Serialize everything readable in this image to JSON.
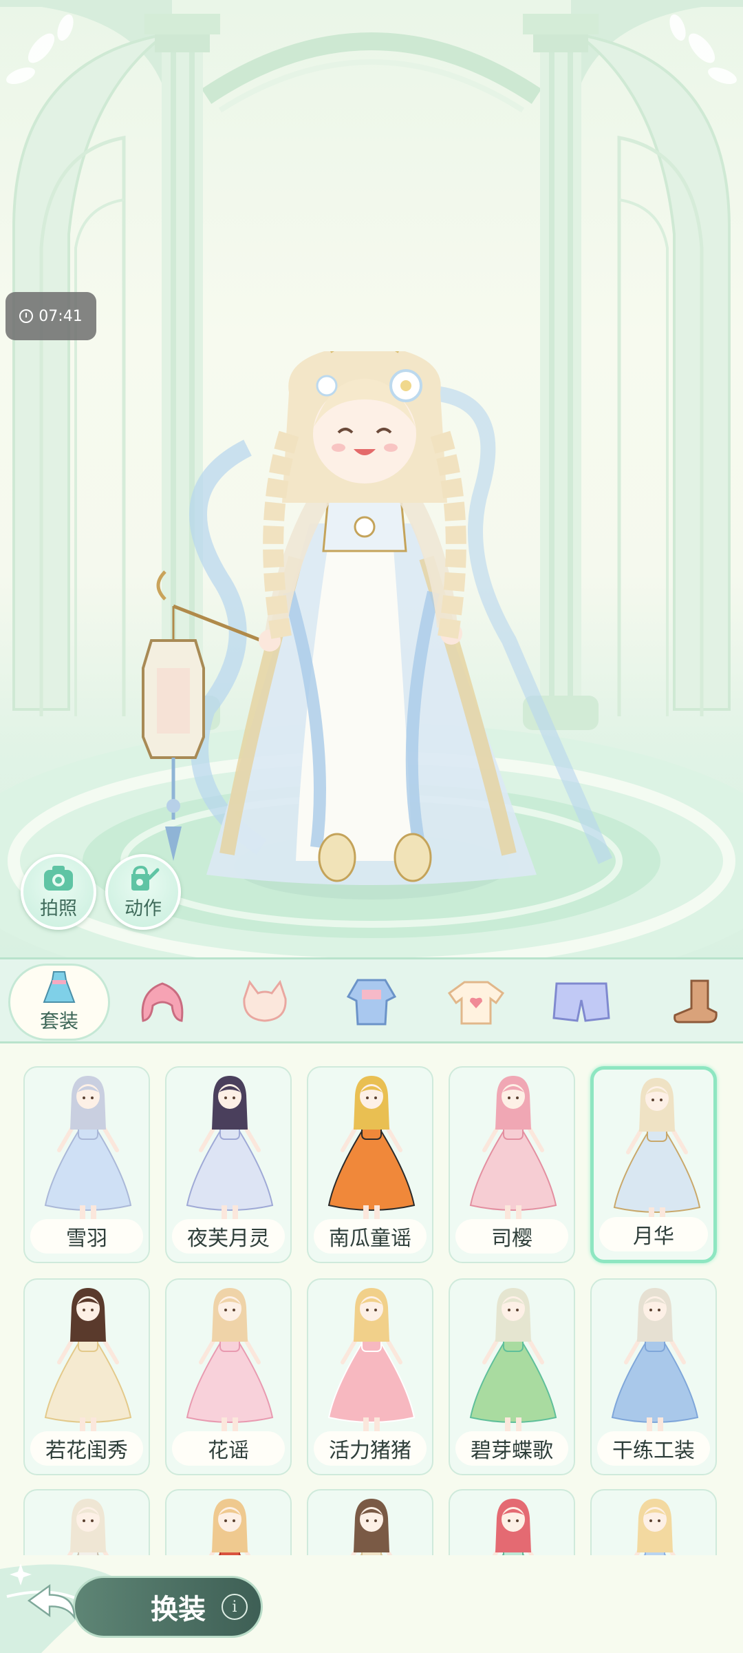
{
  "timer": {
    "time": "07:41",
    "icon": "clock-icon"
  },
  "actions": {
    "photo": {
      "label": "拍照",
      "icon": "camera-icon"
    },
    "motion": {
      "label": "动作",
      "icon": "watering-can-icon"
    }
  },
  "categories": [
    {
      "label": "套装",
      "icon": "dress-icon",
      "active": true
    },
    {
      "label": "",
      "icon": "hair-icon"
    },
    {
      "label": "",
      "icon": "headwear-icon"
    },
    {
      "label": "",
      "icon": "dress-top-icon"
    },
    {
      "label": "",
      "icon": "tshirt-icon"
    },
    {
      "label": "",
      "icon": "shorts-icon"
    },
    {
      "label": "",
      "icon": "boots-icon"
    }
  ],
  "outfits": [
    {
      "name": "雪羽",
      "hair": "#c9cfe0",
      "dress": "#cfe0f5",
      "accent": "#aab8d8"
    },
    {
      "name": "夜芙月灵",
      "hair": "#4a3f5c",
      "dress": "#dde4f4",
      "accent": "#9fa9d6"
    },
    {
      "name": "南瓜童谣",
      "hair": "#e9bf52",
      "dress": "#f0883a",
      "accent": "#2b2b2b"
    },
    {
      "name": "司樱",
      "hair": "#f0a7b4",
      "dress": "#f6cdd3",
      "accent": "#e38fa0"
    },
    {
      "name": "月华",
      "hair": "#efe2c4",
      "dress": "#d9e7f2",
      "accent": "#c9a86b",
      "selected": true
    },
    {
      "name": "若花闺秀",
      "hair": "#5a3a2c",
      "dress": "#f5ead0",
      "accent": "#e3c98a"
    },
    {
      "name": "花谣",
      "hair": "#efd3a8",
      "dress": "#f8d1da",
      "accent": "#e89ab0"
    },
    {
      "name": "活力猪猪",
      "hair": "#f1d08a",
      "dress": "#f7b8c0",
      "accent": "#ffffff"
    },
    {
      "name": "碧芽蝶歌",
      "hair": "#e5e5d0",
      "dress": "#a9dba0",
      "accent": "#5fbf9a"
    },
    {
      "name": "干练工装",
      "hair": "#e6e0d2",
      "dress": "#a9c8ea",
      "accent": "#7fa6d9"
    },
    {
      "name": "",
      "hair": "#efe6d4",
      "dress": "#f3f0ea",
      "accent": "#cfc6b5"
    },
    {
      "name": "",
      "hair": "#efc98f",
      "dress": "#d9533f",
      "accent": "#b8362a"
    },
    {
      "name": "",
      "hair": "#7a5a45",
      "dress": "#f0e3c6",
      "accent": "#d8c393"
    },
    {
      "name": "",
      "hair": "#e46a72",
      "dress": "#bde8d6",
      "accent": "#64b89a"
    },
    {
      "name": "",
      "hair": "#f3d9a0",
      "dress": "#b9d4f0",
      "accent": "#8fb3e3"
    }
  ],
  "bottom": {
    "change_label": "换装",
    "back_icon": "back-arrow-icon",
    "info_icon": "info-icon",
    "info_glyph": "i"
  }
}
